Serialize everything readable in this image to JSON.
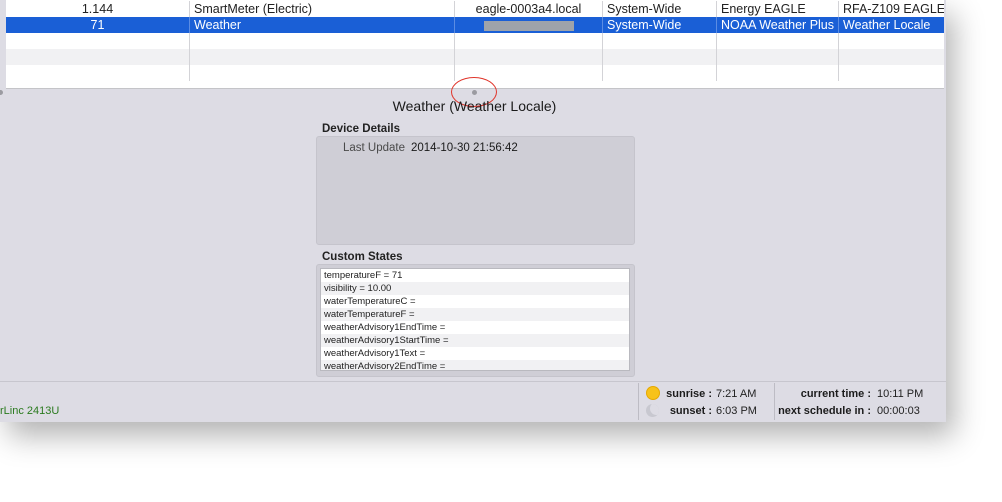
{
  "table": {
    "rows": [
      {
        "address": "1.144",
        "name": "SmartMeter (Electric)",
        "interface": "eagle-0003a4.local",
        "folder": "System-Wide",
        "model": "Energy EAGLE",
        "type": "RFA-Z109 EAGLE",
        "selected": false
      },
      {
        "address": "71",
        "name": "Weather",
        "interface": "",
        "folder": "System-Wide",
        "model": "NOAA Weather Plus",
        "type": "Weather Locale",
        "selected": true
      }
    ]
  },
  "detail": {
    "title": "Weather (Weather Locale)",
    "device_details_label": "Device Details",
    "last_update_key": "Last Update",
    "last_update_value": "2014-10-30 21:56:42",
    "custom_states_label": "Custom States",
    "states": [
      "temperatureF = 71",
      "visibility = 10.00",
      "waterTemperatureC =",
      "waterTemperatureF =",
      "weatherAdvisory1EndTime =",
      "weatherAdvisory1StartTime =",
      "weatherAdvisory1Text =",
      "weatherAdvisory2EndTime ="
    ]
  },
  "footer": {
    "device_name": "rLinc 2413U",
    "sunrise_label": "sunrise :",
    "sunrise_value": "7:21 AM",
    "sunset_label": "sunset :",
    "sunset_value": "6:03 PM",
    "current_time_label": "current time :",
    "current_time_value": "10:11 PM",
    "next_schedule_label": "next schedule in :",
    "next_schedule_value": "00:00:03"
  },
  "colors": {
    "selection": "#1a5fd6",
    "device_name": "#2a7a1e",
    "annotation": "#e0352b"
  },
  "icons": [
    "sun-icon",
    "moon-icon"
  ]
}
